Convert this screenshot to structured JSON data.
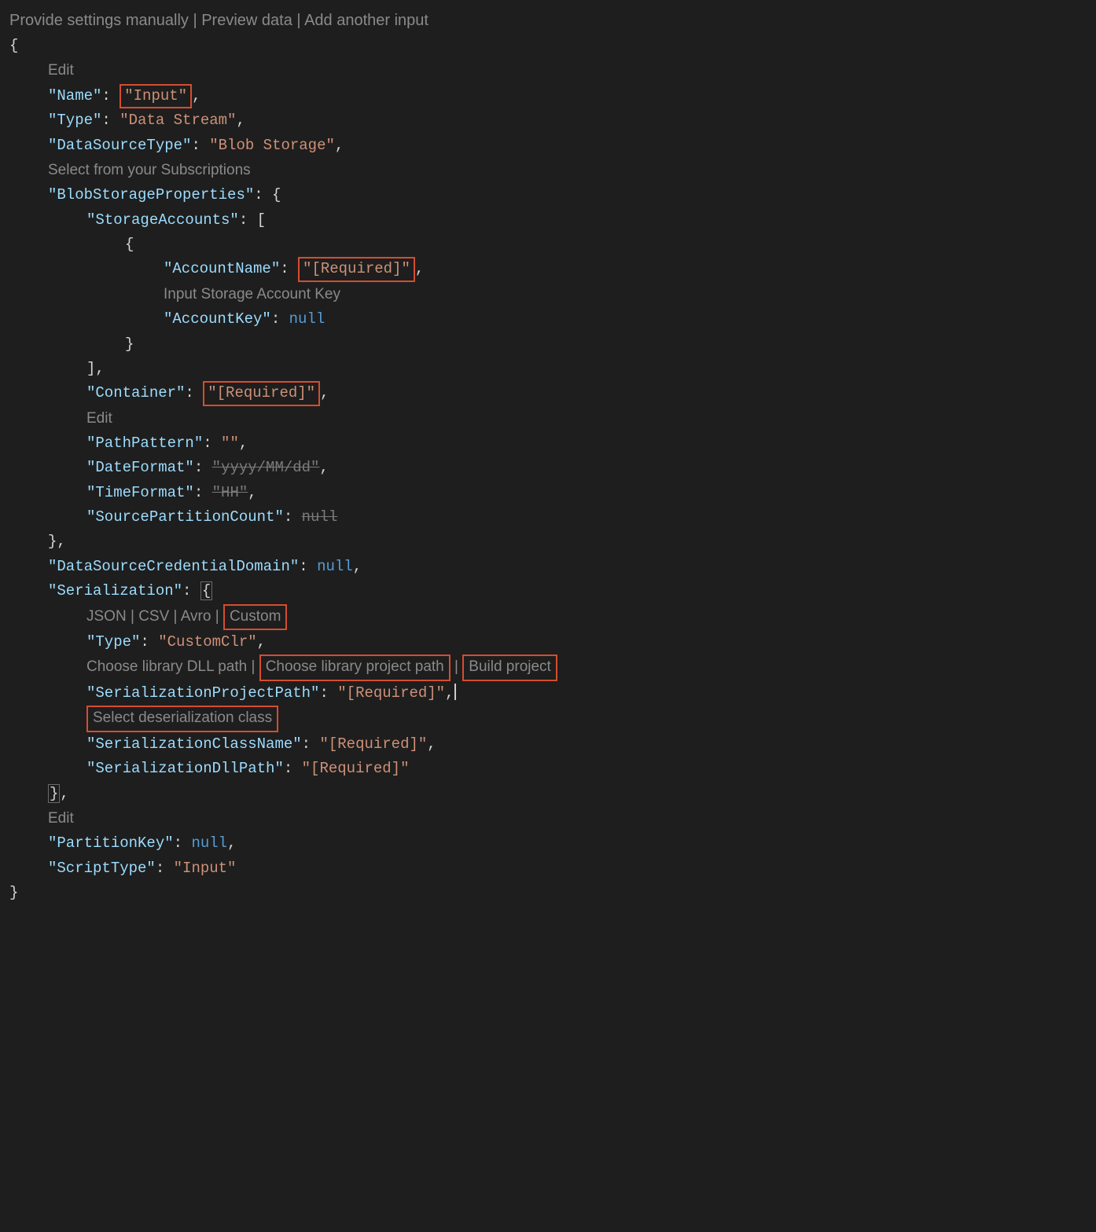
{
  "topLinks": {
    "provide": "Provide settings manually",
    "preview": "Preview data",
    "addInput": "Add another input"
  },
  "hints": {
    "edit1": "Edit",
    "selectSubs": "Select from your Subscriptions",
    "inputStorageKey": "Input Storage Account Key",
    "edit2": "Edit",
    "serFormats": {
      "json": "JSON",
      "csv": "CSV",
      "avro": "Avro",
      "custom": "Custom"
    },
    "chooseDll": "Choose library DLL path",
    "chooseProj": "Choose library project path",
    "buildProj": "Build project",
    "selectDeser": "Select deserialization class",
    "edit3": "Edit"
  },
  "json": {
    "Name": "\"Input\"",
    "Type": "\"Data Stream\"",
    "DataSourceType": "\"Blob Storage\"",
    "BlobStorageProperties": {
      "StorageAccounts": {
        "AccountName": "\"[Required]\"",
        "AccountKey": "null"
      },
      "Container": "\"[Required]\"",
      "PathPattern": "\"\"",
      "DateFormat": "\"yyyy/MM/dd\"",
      "TimeFormat": "\"HH\"",
      "SourcePartitionCount": "null"
    },
    "DataSourceCredentialDomain": "null",
    "Serialization": {
      "Type": "\"CustomClr\"",
      "SerializationProjectPath": "\"[Required]\"",
      "SerializationClassName": "\"[Required]\"",
      "SerializationDllPath": "\"[Required]\""
    },
    "PartitionKey": "null",
    "ScriptType": "\"Input\""
  }
}
